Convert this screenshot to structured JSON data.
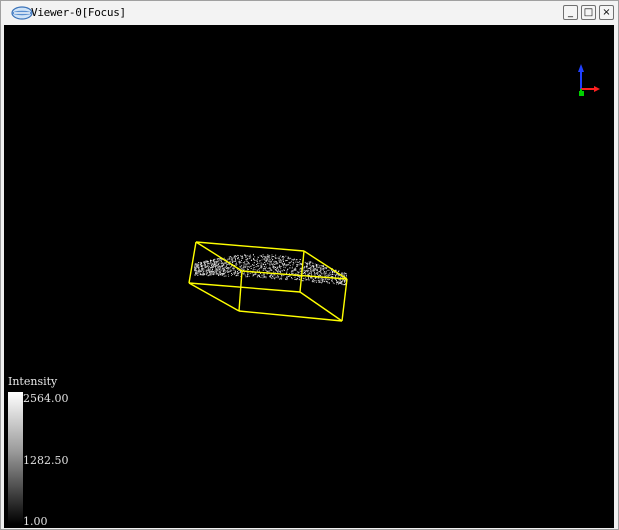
{
  "window": {
    "title": "Viewer-0[Focus]",
    "icon": "viewer-app-icon",
    "controls": {
      "minimize": "_",
      "maximize": "□",
      "close": "×"
    }
  },
  "viewport": {
    "background": "#000000",
    "bounding_box_color": "#ffff00",
    "axes_colors": {
      "x": "#ff0000",
      "y": "#00cc00",
      "z": "#0000ff"
    }
  },
  "scalar_bar": {
    "title": "Intensity",
    "max": "2564.00",
    "mid": "1282.50",
    "min": "1.00"
  }
}
